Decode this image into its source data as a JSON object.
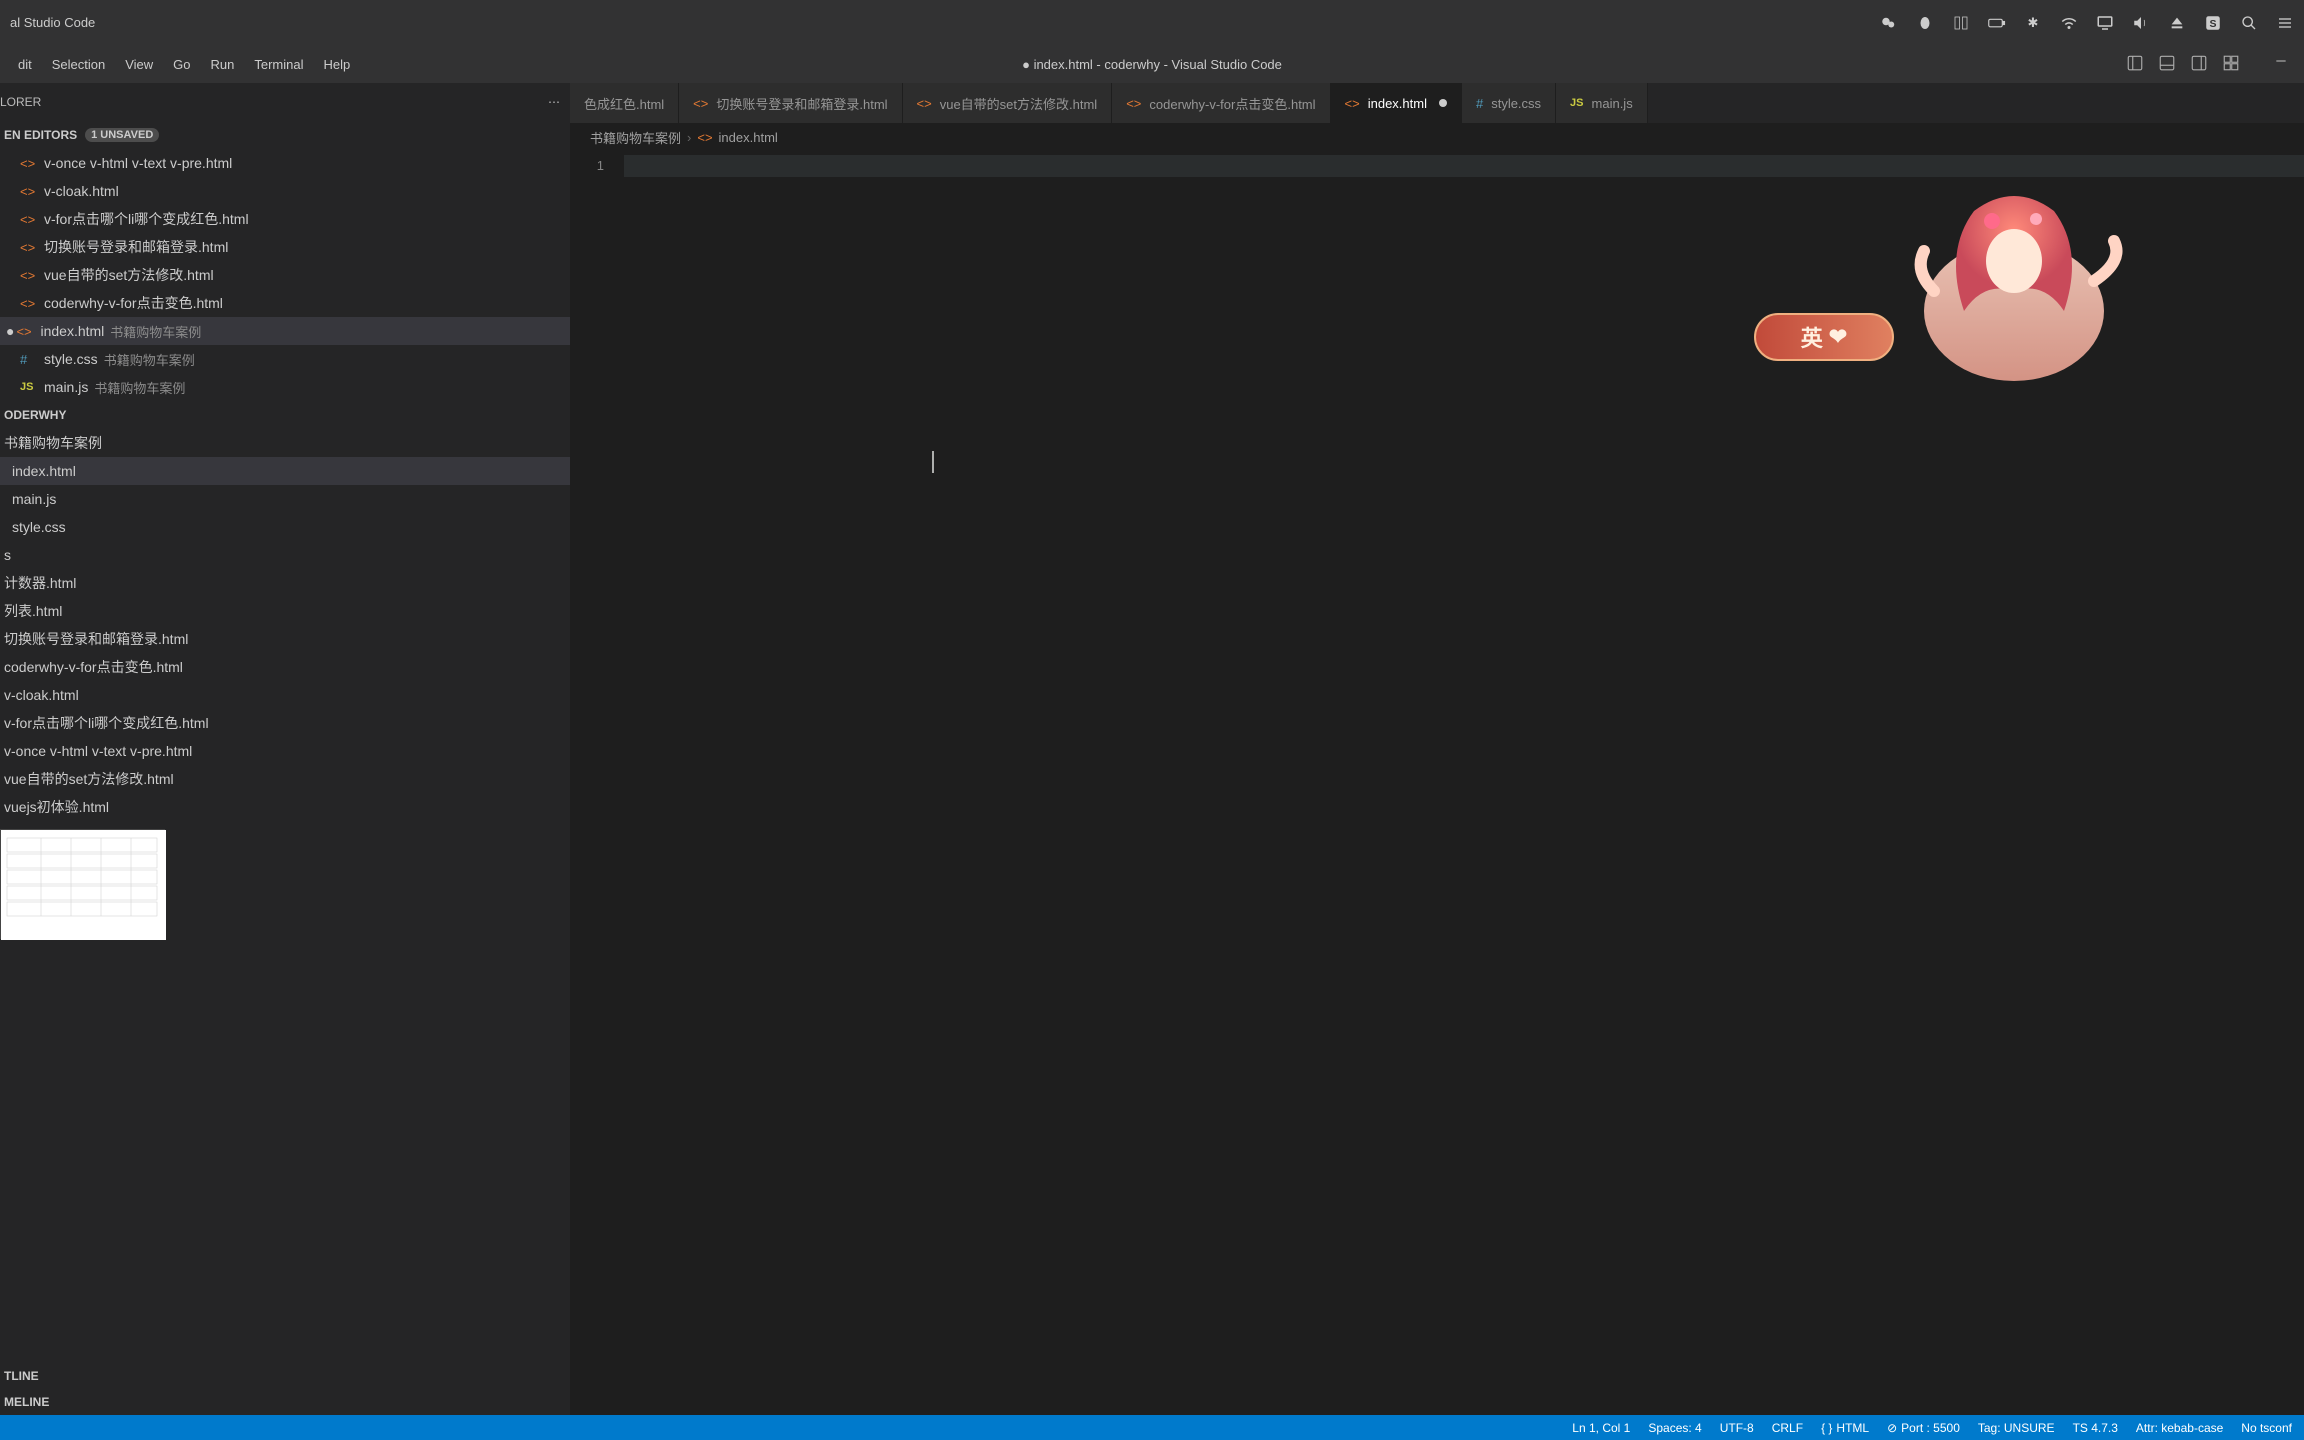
{
  "titlebar": {
    "app_name": "al Studio Code"
  },
  "menubar": {
    "items": [
      "dit",
      "Selection",
      "View",
      "Go",
      "Run",
      "Terminal",
      "Help"
    ],
    "window_title": "● index.html - coderwhy - Visual Studio Code"
  },
  "explorer": {
    "title": "LORER",
    "open_editors_label": "EN EDITORS",
    "unsaved_badge": "1 unsaved",
    "open_editors": [
      {
        "name": "v-once v-html v-text v-pre.html",
        "icon": "html"
      },
      {
        "name": "v-cloak.html",
        "icon": "html"
      },
      {
        "name": "v-for点击哪个li哪个变成红色.html",
        "icon": "html"
      },
      {
        "name": "切换账号登录和邮箱登录.html",
        "icon": "html"
      },
      {
        "name": "vue自带的set方法修改.html",
        "icon": "html"
      },
      {
        "name": "coderwhy-v-for点击变色.html",
        "icon": "html"
      },
      {
        "name": "index.html",
        "icon": "html",
        "folder": "书籍购物车案例",
        "active": true,
        "dirty": true
      },
      {
        "name": "style.css",
        "icon": "css",
        "folder": "书籍购物车案例"
      },
      {
        "name": "main.js",
        "icon": "js",
        "folder": "书籍购物车案例"
      }
    ],
    "workspace_label": "ODERWHY",
    "tree": {
      "folder": "书籍购物车案例",
      "children": [
        {
          "name": "index.html",
          "active": true
        },
        {
          "name": "main.js"
        },
        {
          "name": "style.css"
        }
      ],
      "s_label": "s",
      "root_files": [
        "计数器.html",
        "列表.html",
        "切换账号登录和邮箱登录.html",
        "coderwhy-v-for点击变色.html",
        "v-cloak.html",
        "v-for点击哪个li哪个变成红色.html",
        "v-once v-html v-text v-pre.html",
        "vue自带的set方法修改.html",
        "vuejs初体验.html"
      ]
    },
    "outline_label": "TLINE",
    "timeline_label": "MELINE"
  },
  "tabs": [
    {
      "name": "色成红色.html",
      "icon": "html"
    },
    {
      "name": "切换账号登录和邮箱登录.html",
      "icon": "html"
    },
    {
      "name": "vue自带的set方法修改.html",
      "icon": "html"
    },
    {
      "name": "coderwhy-v-for点击变色.html",
      "icon": "html"
    },
    {
      "name": "index.html",
      "icon": "html",
      "active": true,
      "dirty": true
    },
    {
      "name": "style.css",
      "icon": "css"
    },
    {
      "name": "main.js",
      "icon": "js"
    }
  ],
  "breadcrumb": {
    "parts": [
      "书籍购物车案例",
      "index.html"
    ]
  },
  "editor": {
    "line_number": "1"
  },
  "overlay": {
    "pill_text": "英"
  },
  "statusbar": {
    "cursor": "Ln 1, Col 1",
    "spaces": "Spaces: 4",
    "encoding": "UTF-8",
    "eol": "CRLF",
    "lang": "HTML",
    "port": "Port : 5500",
    "tag": "Tag: UNSURE",
    "ts": "TS 4.7.3",
    "attr": "Attr: kebab-case",
    "tsconf": "No tsconf"
  }
}
